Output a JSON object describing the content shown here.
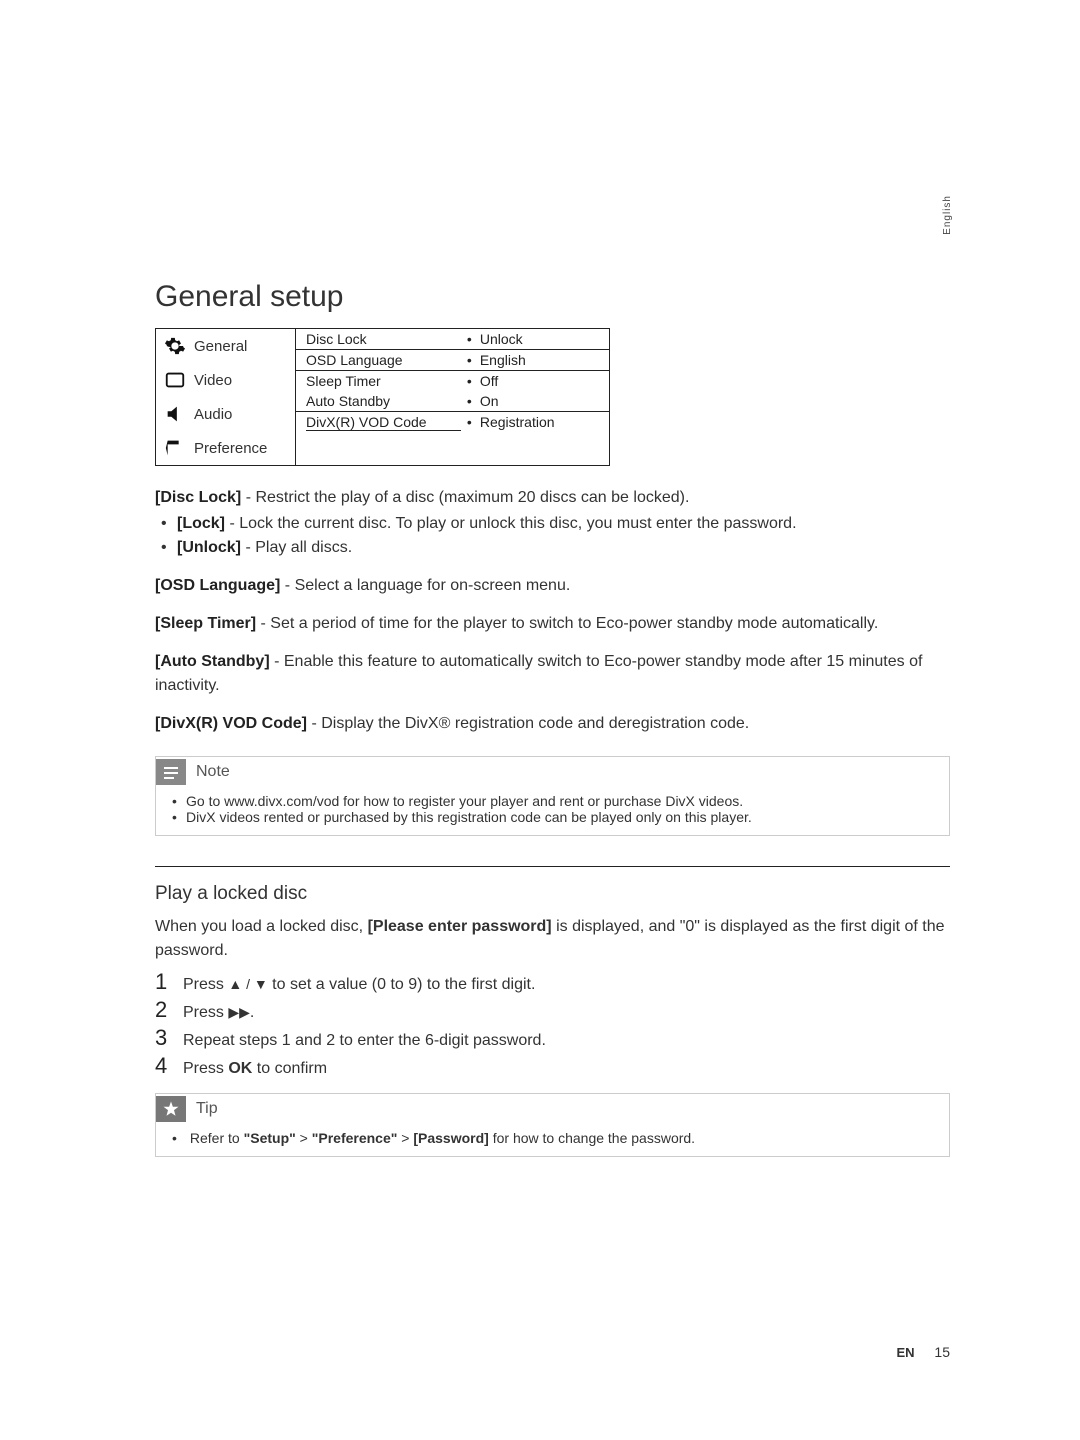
{
  "lang_tab": "English",
  "title": "General setup",
  "osd": {
    "sidebar": [
      {
        "label": "General",
        "selected": true
      },
      {
        "label": "Video",
        "selected": false
      },
      {
        "label": "Audio",
        "selected": false
      },
      {
        "label": "Preference",
        "selected": false
      }
    ],
    "rows": [
      {
        "label": "Disc Lock",
        "value": "Unlock"
      },
      {
        "label": "OSD Language",
        "value": "English"
      },
      {
        "label": "Sleep Timer",
        "value": "Off"
      },
      {
        "label": "Auto Standby",
        "value": "On"
      },
      {
        "label": "DivX(R) VOD Code",
        "value": "Registration"
      }
    ]
  },
  "defs": {
    "disc_lock_label": "[Disc Lock]",
    "disc_lock_text": " - Restrict the play of a disc (maximum 20 discs can be locked).",
    "lock_label": "[Lock]",
    "lock_text": " - Lock the current disc. To play or unlock this disc, you must enter the password.",
    "unlock_label": "[Unlock]",
    "unlock_text": " - Play all discs.",
    "osd_lang_label": "[OSD Language]",
    "osd_lang_text": " - Select a language for on-screen menu.",
    "sleep_label": "[Sleep Timer]",
    "sleep_text": " - Set a period of time for the player to switch to Eco-power standby mode automatically.",
    "auto_standby_label": "[Auto Standby]",
    "auto_standby_text": " - Enable this feature to automatically switch to Eco-power standby mode after 15 minutes of inactivity.",
    "divx_label": "[DivX(R) VOD Code]",
    "divx_text": " - Display the DivX® registration code and deregistration code."
  },
  "note": {
    "title": "Note",
    "items": [
      "Go to www.divx.com/vod for how to register your player and rent or purchase DivX videos.",
      "DivX videos rented or purchased by this registration code can be played only on this player."
    ]
  },
  "locked": {
    "heading": "Play a locked disc",
    "intro_pre": "When you load a locked disc, ",
    "intro_bold": "[Please enter password]",
    "intro_post": " is displayed, and \"0\" is displayed as the first digit of the password.",
    "steps": {
      "s1_pre": "Press ",
      "s1_glyph": "▲ / ▼",
      "s1_post": " to set a value (0 to 9) to the first digit.",
      "s2_pre": "Press ",
      "s2_glyph": "▶▶",
      "s2_post": ".",
      "s3": "Repeat steps 1 and 2 to enter the 6-digit password.",
      "s4_pre": "Press ",
      "s4_bold": "OK",
      "s4_post": " to confirm"
    }
  },
  "tip": {
    "title": "Tip",
    "pre": "Refer to ",
    "b1": "\"Setup\"",
    "mid1": " > ",
    "b2": "\"Preference\"",
    "mid2": " > ",
    "b3": "[Password]",
    "post": " for how to change the password."
  },
  "footer": {
    "lang": "EN",
    "page": "15"
  }
}
